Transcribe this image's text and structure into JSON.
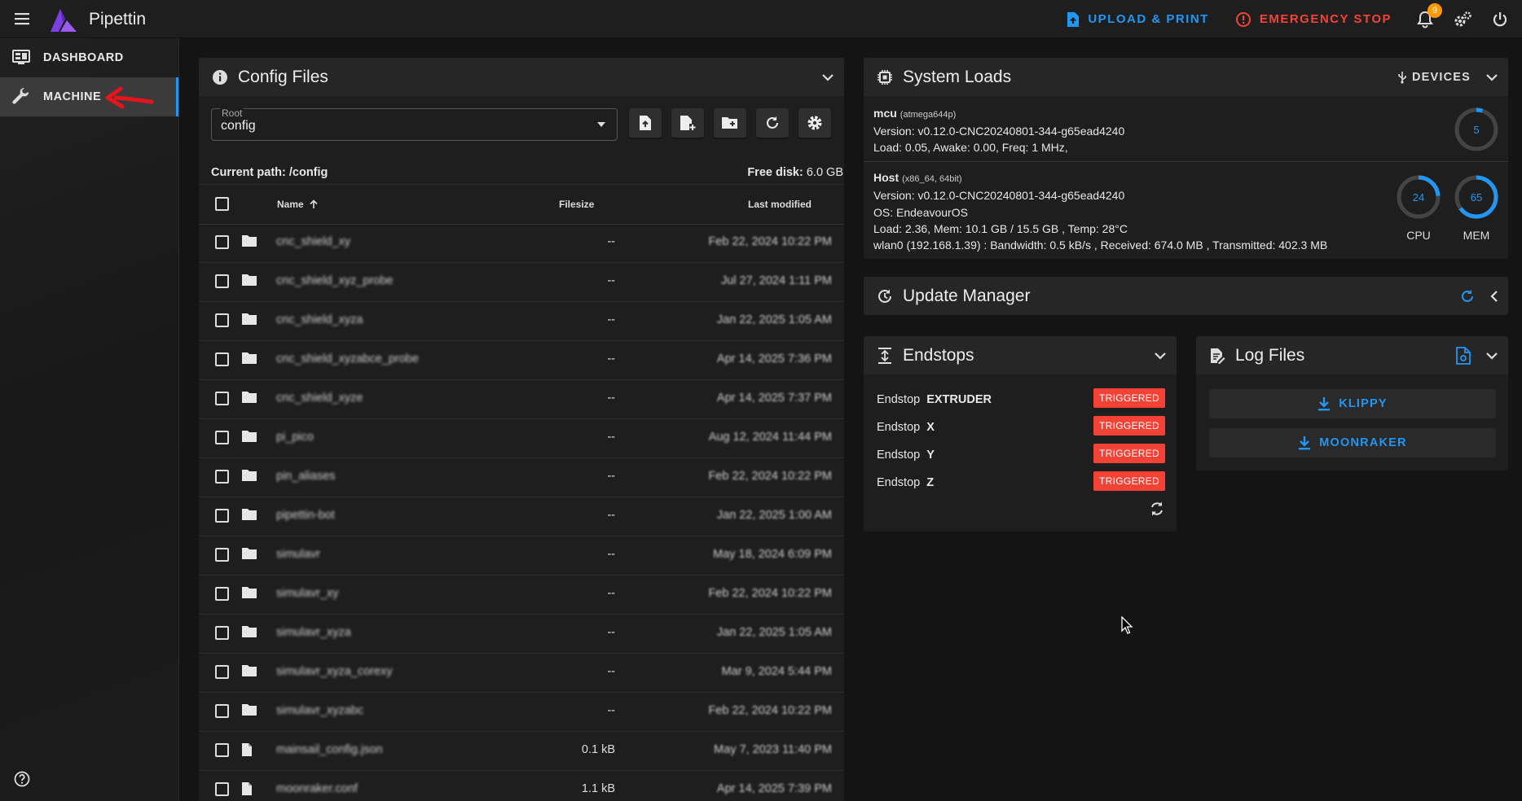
{
  "app": {
    "title": "Pipettin"
  },
  "topbar": {
    "upload_label": "UPLOAD & PRINT",
    "estop_label": "EMERGENCY STOP",
    "notification_count": "9",
    "accent": "#2196f3",
    "danger": "#f44336"
  },
  "sidebar": {
    "items": [
      {
        "label": "DASHBOARD",
        "icon": "monitor-dashboard-icon"
      },
      {
        "label": "MACHINE",
        "icon": "wrench-icon"
      }
    ]
  },
  "config_files": {
    "title": "Config Files",
    "root_label": "Root",
    "root_value": "config",
    "current_path_label": "Current path:",
    "current_path": "/config",
    "free_disk_label": "Free disk:",
    "free_disk": "6.0 GB",
    "columns": {
      "name": "Name",
      "size": "Filesize",
      "modified": "Last modified"
    },
    "rows": [
      {
        "name": "cnc_shield_xy",
        "type": "folder",
        "size": "--",
        "modified": "Feb 22, 2024 10:22 PM"
      },
      {
        "name": "cnc_shield_xyz_probe",
        "type": "folder",
        "size": "--",
        "modified": "Jul 27, 2024 1:11 PM"
      },
      {
        "name": "cnc_shield_xyza",
        "type": "folder",
        "size": "--",
        "modified": "Jan 22, 2025 1:05 AM"
      },
      {
        "name": "cnc_shield_xyzabce_probe",
        "type": "folder",
        "size": "--",
        "modified": "Apr 14, 2025 7:36 PM"
      },
      {
        "name": "cnc_shield_xyze",
        "type": "folder",
        "size": "--",
        "modified": "Apr 14, 2025 7:37 PM"
      },
      {
        "name": "pi_pico",
        "type": "folder",
        "size": "--",
        "modified": "Aug 12, 2024 11:44 PM"
      },
      {
        "name": "pin_aliases",
        "type": "folder",
        "size": "--",
        "modified": "Feb 22, 2024 10:22 PM"
      },
      {
        "name": "pipettin-bot",
        "type": "folder",
        "size": "--",
        "modified": "Jan 22, 2025 1:00 AM"
      },
      {
        "name": "simulavr",
        "type": "folder",
        "size": "--",
        "modified": "May 18, 2024 6:09 PM"
      },
      {
        "name": "simulavr_xy",
        "type": "folder",
        "size": "--",
        "modified": "Feb 22, 2024 10:22 PM"
      },
      {
        "name": "simulavr_xyza",
        "type": "folder",
        "size": "--",
        "modified": "Jan 22, 2025 1:05 AM"
      },
      {
        "name": "simulavr_xyza_corexy",
        "type": "folder",
        "size": "--",
        "modified": "Mar 9, 2024 5:44 PM"
      },
      {
        "name": "simulavr_xyzabc",
        "type": "folder",
        "size": "--",
        "modified": "Feb 22, 2024 10:22 PM"
      },
      {
        "name": "mainsail_config.json",
        "type": "file",
        "size": "0.1 kB",
        "modified": "May 7, 2023 11:40 PM"
      },
      {
        "name": "moonraker.conf",
        "type": "file",
        "size": "1.1 kB",
        "modified": "Apr 14, 2025 7:39 PM"
      }
    ]
  },
  "system_loads": {
    "title": "System Loads",
    "devices_label": "DEVICES",
    "mcu": {
      "name": "mcu",
      "meta": "(atmega644p)",
      "version": "Version: v0.12.0-CNC20240801-344-g65ead4240",
      "load": "Load: 0.05, Awake: 0.00, Freq: 1 MHz,",
      "gauge": "5"
    },
    "host": {
      "name": "Host",
      "meta": "(x86_64, 64bit)",
      "version": "Version: v0.12.0-CNC20240801-344-g65ead4240",
      "os": "OS: EndeavourOS",
      "load": "Load: 2.36, Mem: 10.1 GB / 15.5 GB , Temp: 28°C",
      "network": "wlan0 (192.168.1.39) : Bandwidth: 0.5 kB/s , Received: 674.0 MB , Transmitted: 402.3 MB",
      "cpu_value": "24",
      "cpu_label": "CPU",
      "mem_value": "65",
      "mem_label": "MEM"
    }
  },
  "update_manager": {
    "title": "Update Manager"
  },
  "endstops": {
    "title": "Endstops",
    "items": [
      {
        "label": "Endstop",
        "axis": "EXTRUDER",
        "state": "TRIGGERED"
      },
      {
        "label": "Endstop",
        "axis": "X",
        "state": "TRIGGERED"
      },
      {
        "label": "Endstop",
        "axis": "Y",
        "state": "TRIGGERED"
      },
      {
        "label": "Endstop",
        "axis": "Z",
        "state": "TRIGGERED"
      }
    ]
  },
  "log_files": {
    "title": "Log Files",
    "buttons": [
      {
        "label": "KLIPPY"
      },
      {
        "label": "MOONRAKER"
      }
    ]
  }
}
